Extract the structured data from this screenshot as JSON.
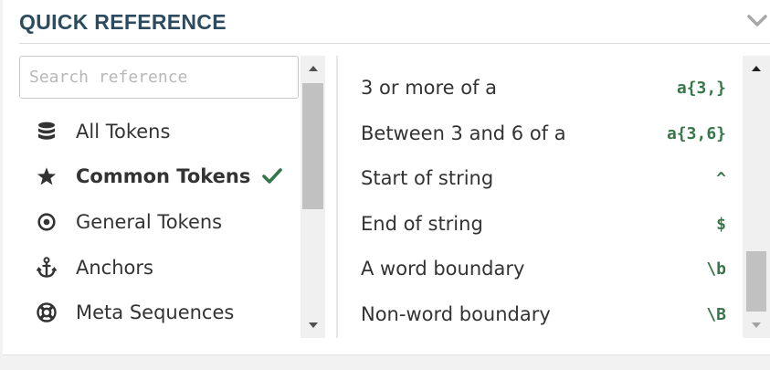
{
  "header": {
    "title": "QUICK REFERENCE",
    "collapse_icon": "chevron-down-icon"
  },
  "search": {
    "placeholder": "Search reference",
    "value": ""
  },
  "categories": [
    {
      "label": "All Tokens",
      "icon": "database-icon"
    },
    {
      "label": "Common Tokens",
      "icon": "star-icon",
      "active": true,
      "check_icon": "checkmark-icon"
    },
    {
      "label": "General Tokens",
      "icon": "target-icon"
    },
    {
      "label": "Anchors",
      "icon": "anchor-icon"
    },
    {
      "label": "Meta Sequences",
      "icon": "lifebuoy-icon"
    }
  ],
  "tokens": [
    {
      "description": "3 or more of a",
      "code": "a{3,}"
    },
    {
      "description": "Between 3 and 6 of a",
      "code": "a{3,6}"
    },
    {
      "description": "Start of string",
      "code": "^"
    },
    {
      "description": "End of string",
      "code": "$"
    },
    {
      "description": "A word boundary",
      "code": "\\b"
    },
    {
      "description": "Non-word boundary",
      "code": "\\B"
    }
  ],
  "colors": {
    "title": "#2d4b5f",
    "code": "#37764a",
    "check": "#37764a"
  }
}
